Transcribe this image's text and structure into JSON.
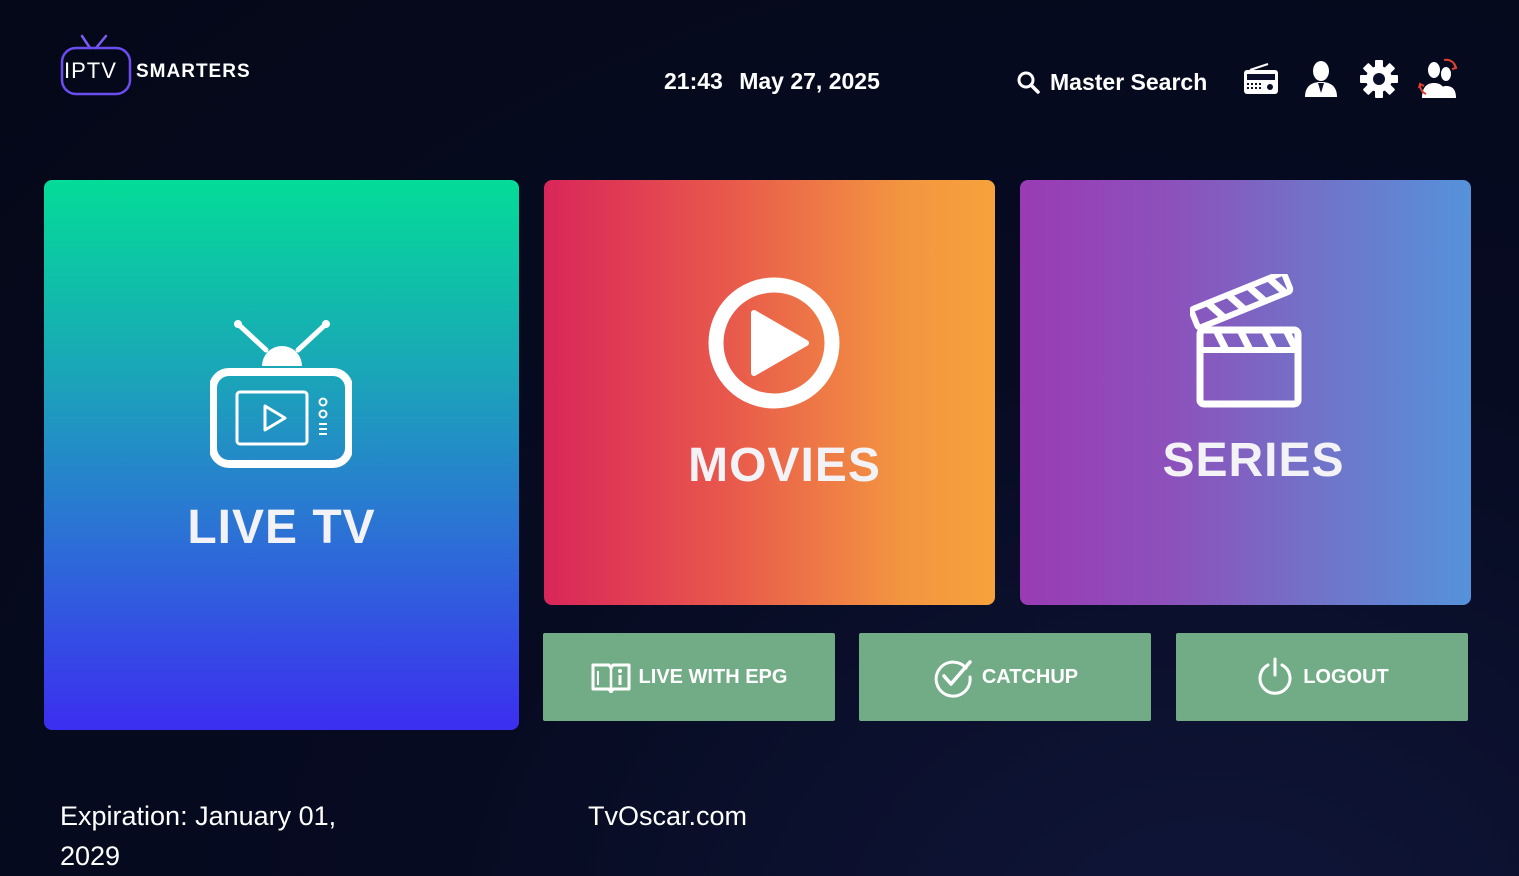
{
  "header": {
    "logo": {
      "part_a": "IPTV",
      "part_b": "SMARTERS"
    },
    "clock": {
      "time": "21:43",
      "date": "May 27, 2025"
    },
    "search_label": "Master Search",
    "icons": [
      "radio-icon",
      "user-icon",
      "gear-icon",
      "switch-user-icon"
    ]
  },
  "tiles": {
    "live_tv": {
      "label": "LIVE TV",
      "icon": "tv-icon"
    },
    "movies": {
      "label": "MOVIES",
      "icon": "play-circle-icon"
    },
    "series": {
      "label": "SERIES",
      "icon": "clapperboard-icon"
    }
  },
  "buttons": {
    "epg": {
      "label": "LIVE WITH EPG",
      "icon": "book-info-icon"
    },
    "catchup": {
      "label": "CATCHUP",
      "icon": "check-circle-icon"
    },
    "logout": {
      "label": "LOGOUT",
      "icon": "power-icon"
    }
  },
  "footer": {
    "expiration": "Expiration: January 01, 2029",
    "site": "TvOscar.com"
  },
  "colors": {
    "background": "#050818",
    "button": "#72ac86",
    "text": "#ffffff"
  }
}
